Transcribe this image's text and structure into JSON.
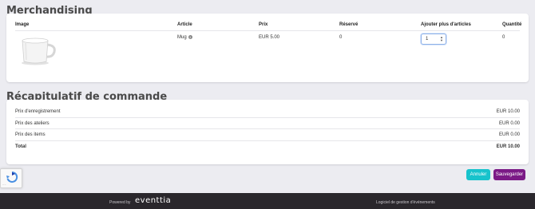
{
  "merch": {
    "title": "Merchandising",
    "headers": {
      "image": "Image",
      "article": "Article",
      "price": "Prix",
      "reserved": "Réservé",
      "add_more": "Ajouter plus d'articles",
      "quantity": "Quantité"
    },
    "row": {
      "article": "Mug",
      "info_icon": "info-icon",
      "price": "EUR 5.00",
      "reserved": "0",
      "add_value": "1",
      "quantity": "0"
    }
  },
  "summary": {
    "title": "Récapitulatif de commande",
    "rows": [
      {
        "label": "Prix d'enregistrement",
        "value": "EUR 10.00"
      },
      {
        "label": "Prix des ateliers",
        "value": "EUR 0.00"
      },
      {
        "label": "Prix des items",
        "value": "EUR 0.00"
      }
    ],
    "total_label": "Total",
    "total_value": "EUR 10.00"
  },
  "buttons": {
    "cancel": "Annuler",
    "save": "Sauvegarder"
  },
  "footer": {
    "powered_by": "Powered by",
    "brand": "eventtia",
    "tagline": "Logiciel de gestion d'événements"
  },
  "colors": {
    "cancel_button": "#17c3cc",
    "save_button": "#7b1a86",
    "footer_bg": "#2a272c"
  }
}
